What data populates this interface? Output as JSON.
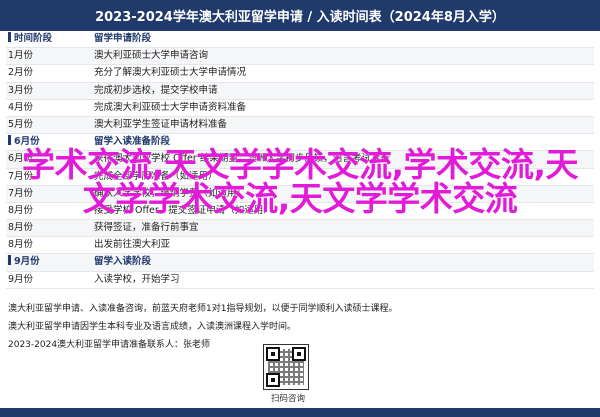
{
  "banner": {
    "title": "2023-2024学年澳大利亚留学申请 / 入读时间表（2024年8月入学）"
  },
  "timeline": [
    {
      "time": "时间阶段",
      "item": "留学申请阶段",
      "header": true
    },
    {
      "time": "1月份",
      "item": "澳大利亚硕士大学申请咨询"
    },
    {
      "time": "2月份",
      "item": "充分了解澳大利亚硕士大学申请情况"
    },
    {
      "time": "3月份",
      "item": "完成初步选校，提交学校申请"
    },
    {
      "time": "4月份",
      "item": "完成澳大利亚硕士大学申请资料准备"
    },
    {
      "time": "5月份",
      "item": "澳大利亚学生签证申请材料准备"
    },
    {
      "time": "6月份",
      "item": "留学入读准备阶段",
      "header": true
    },
    {
      "time": "6月份",
      "item": "获得澳大利亚学校 Offer 结果期望，澳洲大学初步反馈，语言考试准备"
    },
    {
      "time": "7月份",
      "item": "完成全部学历准备（如适用）"
    },
    {
      "time": "7月份",
      "item": "确认入学学校，缴纳学费（如适用）"
    },
    {
      "time": "8月份",
      "item": "接受学校 Offer，提交签证申请（如适用）"
    },
    {
      "time": "8月份",
      "item": "获得签证，准备行前事宜"
    },
    {
      "time": "8月份",
      "item": "出发前往澳大利亚"
    },
    {
      "time": "9月份",
      "item": "留学入读阶段",
      "header": true
    },
    {
      "time": "9月份",
      "item": "入读学校，开始学习"
    }
  ],
  "overlay": {
    "text": "学术交流,天文学学术交流,学术交流,天文学学术交流,天文学学术交流"
  },
  "notes": [
    "澳大利亚留学申请、入读准备咨询，前蓝天府老师1对1指导规划，以便于同学顺利入读硕士课程。",
    "澳大利亚留学申请因学生本科专业及语言成绩，入读澳洲课程入学时间。",
    "2023-2024澳大利亚留学申请准备联系人：张老师"
  ],
  "qr": {
    "caption": "扫码咨询"
  }
}
